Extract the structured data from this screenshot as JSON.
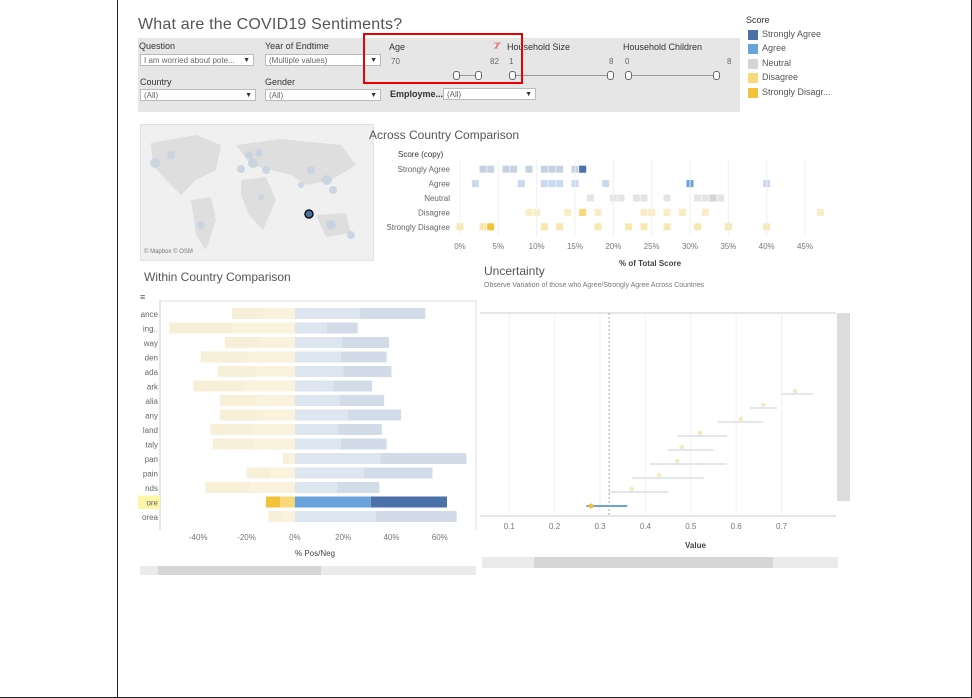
{
  "header": {
    "title": "What are the COVID19 Sentiments?"
  },
  "filters": {
    "question": {
      "label": "Question",
      "value": "I am worried about pote..."
    },
    "year_endtime": {
      "label": "Year of Endtime",
      "value": "(Multiple values)"
    },
    "country": {
      "label": "Country",
      "value": "(All)"
    },
    "gender": {
      "label": "Gender",
      "value": "(All)"
    },
    "age": {
      "label": "Age",
      "min": "70",
      "max": "82"
    },
    "household_size": {
      "label": "Household Size",
      "min": "1",
      "max": "8"
    },
    "household_children": {
      "label": "Household Children",
      "min": "0",
      "max": "8"
    },
    "employment": {
      "label": "Employme...",
      "value": "(All)"
    }
  },
  "legend": {
    "title": "Score",
    "items": [
      {
        "label": "Strongly Agree",
        "color": "#4a72a8"
      },
      {
        "label": "Agree",
        "color": "#6aa3db"
      },
      {
        "label": "Neutral",
        "color": "#d4d4d4"
      },
      {
        "label": "Disagree",
        "color": "#f8d878"
      },
      {
        "label": "Strongly Disagr...",
        "color": "#f2c23b"
      }
    ]
  },
  "map": {
    "attribution": "© Mapbox  © OSM"
  },
  "across": {
    "title": "Across Country Comparison",
    "header": "Score (copy)",
    "xlabel": "% of Total Score"
  },
  "within": {
    "title": "Within Country Comparison",
    "xlabel": "% Pos/Neg"
  },
  "uncertainty": {
    "title": "Uncertainty",
    "subtitle": "Observe Variation of those who Agree/Strongly Agree Across Countries",
    "xlabel": "Value"
  },
  "chart_data": [
    {
      "type": "scatter",
      "title": "Across Country Comparison",
      "xlabel": "% of Total Score",
      "ylabel": "Score (copy)",
      "categories": [
        "Strongly Agree",
        "Agree",
        "Neutral",
        "Disagree",
        "Strongly Disagree"
      ],
      "x_ticks": [
        "0%",
        "5%",
        "10%",
        "15%",
        "20%",
        "25%",
        "30%",
        "35%",
        "40%",
        "45%"
      ],
      "xlim": [
        0,
        48
      ],
      "series": [
        {
          "category": "Strongly Agree",
          "values": [
            3,
            4,
            6,
            7,
            9,
            11,
            12,
            13,
            15,
            16
          ],
          "highlight": 16
        },
        {
          "category": "Agree",
          "values": [
            2,
            8,
            11,
            12,
            13,
            15,
            19,
            30,
            40
          ],
          "highlight": 30
        },
        {
          "category": "Neutral",
          "values": [
            17,
            20,
            21,
            23,
            24,
            27,
            31,
            32,
            33,
            34
          ],
          "highlight": 33
        },
        {
          "category": "Disagree",
          "values": [
            9,
            10,
            14,
            16,
            18,
            24,
            25,
            27,
            29,
            32,
            47
          ],
          "highlight": 16
        },
        {
          "category": "Strongly Disagree",
          "values": [
            0,
            3,
            11,
            13,
            18,
            22,
            24,
            27,
            31,
            35,
            40
          ],
          "highlight": 4
        }
      ]
    },
    {
      "type": "bar",
      "title": "Within Country Comparison",
      "xlabel": "% Pos/Neg",
      "x_ticks": [
        "-40%",
        "-20%",
        "0%",
        "20%",
        "40%",
        "60%"
      ],
      "xlim": [
        -55,
        75
      ],
      "categories": [
        "ance",
        "ing..",
        "way",
        "den",
        "ada",
        "ark",
        "alia",
        "any",
        "land",
        "taly",
        "pan",
        "pain",
        "nds",
        "ore",
        "orea"
      ],
      "negative": [
        -26,
        -52,
        -29,
        -39,
        -32,
        -42,
        -31,
        -31,
        -35,
        -34,
        -5,
        -20,
        -37,
        -12,
        -11
      ],
      "positive": [
        54,
        26,
        39,
        38,
        40,
        32,
        37,
        44,
        36,
        38,
        71,
        57,
        35,
        63,
        67
      ],
      "highlight": "ore"
    },
    {
      "type": "scatter",
      "title": "Uncertainty",
      "xlabel": "Value",
      "x_ticks": [
        "0.1",
        "0.2",
        "0.3",
        "0.4",
        "0.5",
        "0.6",
        "0.7"
      ],
      "xlim": [
        0.04,
        0.82
      ],
      "reference_line": 0.32,
      "points": [
        {
          "value": 0.73,
          "low": 0.7,
          "high": 0.77
        },
        {
          "value": 0.66,
          "low": 0.63,
          "high": 0.69
        },
        {
          "value": 0.61,
          "low": 0.56,
          "high": 0.66
        },
        {
          "value": 0.52,
          "low": 0.47,
          "high": 0.58
        },
        {
          "value": 0.48,
          "low": 0.45,
          "high": 0.55
        },
        {
          "value": 0.47,
          "low": 0.41,
          "high": 0.58
        },
        {
          "value": 0.43,
          "low": 0.37,
          "high": 0.53
        },
        {
          "value": 0.37,
          "low": 0.32,
          "high": 0.45
        },
        {
          "value": 0.28,
          "low": 0.27,
          "high": 0.36,
          "highlight": true
        }
      ]
    }
  ]
}
